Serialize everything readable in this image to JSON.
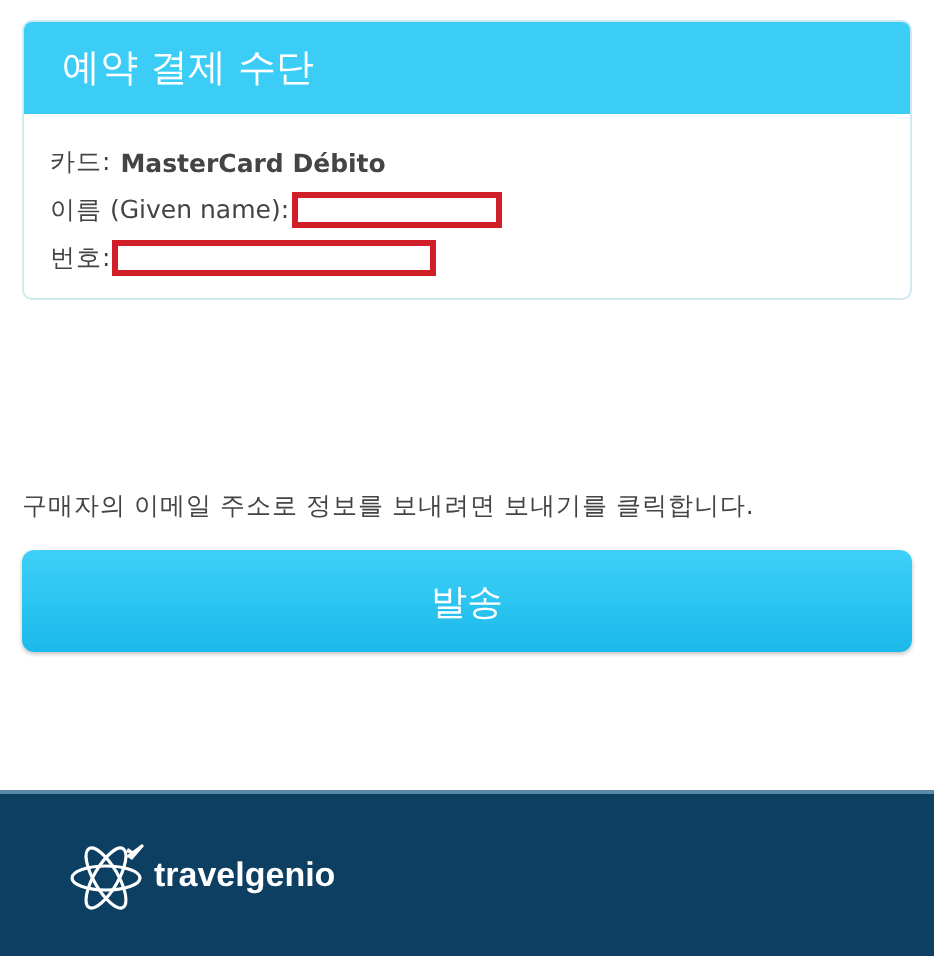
{
  "payment_card": {
    "title": "예약 결제 수단",
    "fields": [
      {
        "label": "카드:",
        "value": "MasterCard Débito"
      },
      {
        "label": "이름 (Given name):",
        "redacted": true
      },
      {
        "label": "번호:",
        "redacted": true
      }
    ]
  },
  "email_hint": "구매자의 이메일 주소로 정보를 보내려면 보내기를 클릭합니다.",
  "send_button": "발송",
  "footer": {
    "brand": "travelgenio"
  }
}
